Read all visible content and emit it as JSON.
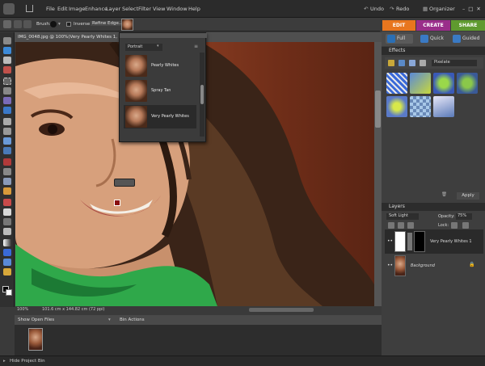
{
  "menu": {
    "items": [
      "File",
      "Edit",
      "Image",
      "Enhance",
      "Layer",
      "Select",
      "Filter",
      "View",
      "Window",
      "Help"
    ],
    "undo": "Undo",
    "redo": "Redo",
    "organizer": "Organizer"
  },
  "modes": {
    "edit": "EDIT",
    "create": "CREATE",
    "share": "SHARE",
    "full": "Full",
    "quick": "Quick",
    "guided": "Guided"
  },
  "options": {
    "brush": "Brush:",
    "inverse": "Inverse",
    "refine_edge": "Refine Edge..."
  },
  "document": {
    "title": "IMG_0048.jpg @ 100%(Very Pearly Whites 1, Layer Mask/8)",
    "zoom": "100%",
    "dimensions": "101.6 cm x 144.82 cm (72 ppi)"
  },
  "presets": {
    "category": "Portrait",
    "items": [
      "Pearly Whites",
      "Spray Tan",
      "Very Pearly Whites"
    ]
  },
  "effects": {
    "header": "Effects",
    "dropdown": "Pixelate",
    "apply": "Apply"
  },
  "layers": {
    "header": "Layers",
    "blend_mode": "Soft Light",
    "opacity_label": "Opacity:",
    "opacity_value": "75%",
    "lock_label": "Lock:",
    "items": [
      "Very Pearly Whites 1",
      "Background"
    ]
  },
  "bin": {
    "show_files": "Show Open Files",
    "actions": "Bin Actions",
    "hide": "Hide Project Bin"
  },
  "colors": {
    "edit_tab": "#e8761e",
    "create_tab": "#9a2e8a",
    "share_tab": "#5f9a2f",
    "selected_preset": "#2a2a2a"
  }
}
